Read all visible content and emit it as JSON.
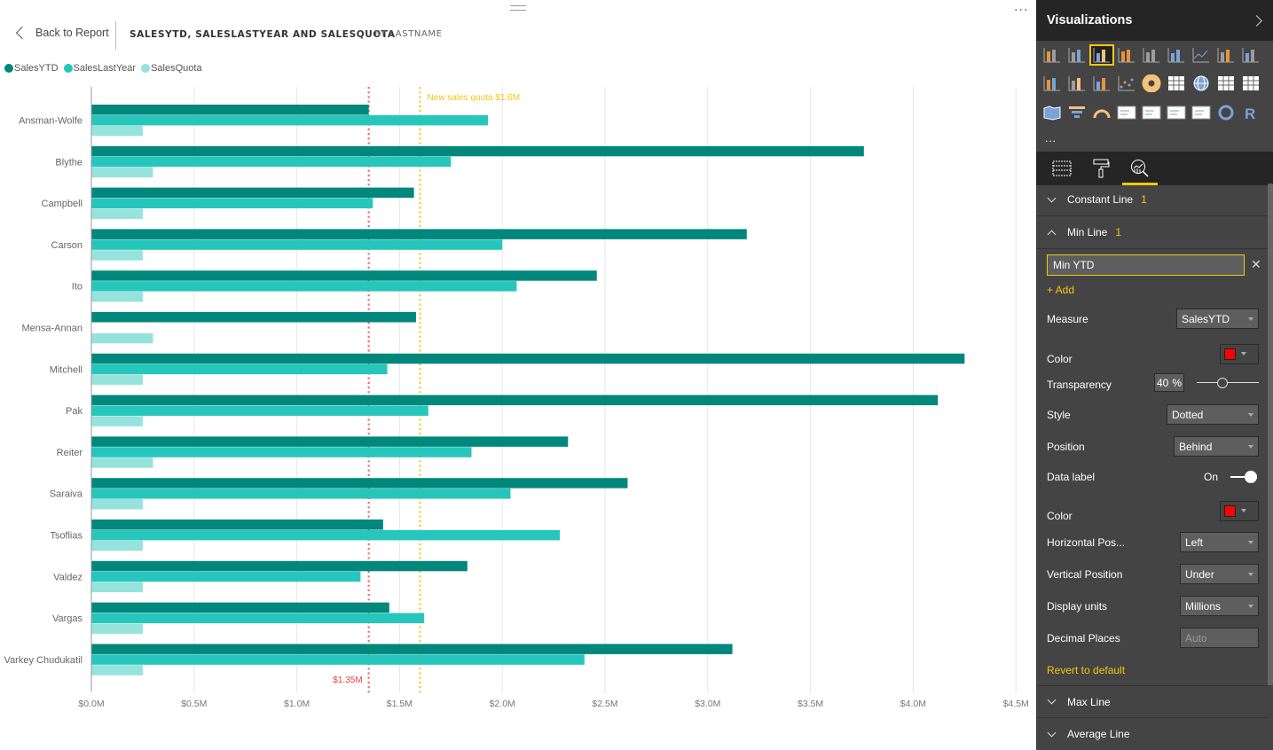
{
  "report": {
    "back_label": "Back to Report",
    "title": "SALESYTD, SALESLASTYEAR AND SALESQUOTA",
    "subtitle": "BY LASTNAME",
    "more_label": "...",
    "legend": [
      {
        "name": "SalesYTD",
        "color": "#01877b"
      },
      {
        "name": "SalesLastYear",
        "color": "#26c6bc"
      },
      {
        "name": "SalesQuota",
        "color": "#95e3dc"
      }
    ]
  },
  "chart_data": {
    "type": "bar",
    "orientation": "horizontal",
    "title": "SalesYTD, SalesLastYear and SalesQuota by LastName",
    "xlabel": "",
    "ylabel": "",
    "xlim": [
      0,
      4.5
    ],
    "units": "$M",
    "grid": true,
    "legend_position": "top-left",
    "x_ticks": [
      "$0.0M",
      "$0.5M",
      "$1.0M",
      "$1.5M",
      "$2.0M",
      "$2.5M",
      "$3.0M",
      "$3.5M",
      "$4.0M",
      "$4.5M"
    ],
    "x_tick_values": [
      0,
      0.5,
      1.0,
      1.5,
      2.0,
      2.5,
      3.0,
      3.5,
      4.0,
      4.5
    ],
    "categories": [
      "Ansman-Wolfe",
      "Blythe",
      "Campbell",
      "Carson",
      "Ito",
      "Mensa-Annan",
      "Mitchell",
      "Pak",
      "Reiter",
      "Saraiva",
      "Tsoflias",
      "Valdez",
      "Vargas",
      "Varkey Chudukatil"
    ],
    "series": [
      {
        "name": "SalesYTD",
        "color": "#01877b",
        "values": [
          1.35,
          3.76,
          1.57,
          3.19,
          2.46,
          1.58,
          4.25,
          4.12,
          2.32,
          2.61,
          1.42,
          1.83,
          1.45,
          3.12
        ]
      },
      {
        "name": "SalesLastYear",
        "color": "#26c6bc",
        "values": [
          1.93,
          1.75,
          1.37,
          2.0,
          2.07,
          0,
          1.44,
          1.64,
          1.85,
          2.04,
          2.28,
          1.31,
          1.62,
          2.4
        ]
      },
      {
        "name": "SalesQuota",
        "color": "#95e3dc",
        "values": [
          0.25,
          0.3,
          0.25,
          0.25,
          0.25,
          0.3,
          0.25,
          0.25,
          0.3,
          0.25,
          0.25,
          0.25,
          0.25,
          0.25
        ]
      }
    ],
    "reference_lines": [
      {
        "name": "Min YTD",
        "type": "min",
        "value": 1.35,
        "label": "$1.35M",
        "color": "#e8413c",
        "style": "dotted",
        "label_position": "bottom-left"
      },
      {
        "name": "New sales quota",
        "type": "constant",
        "value": 1.6,
        "label": "New sales quota $1.6M",
        "color": "#f2c811",
        "style": "dotted",
        "label_position": "top-right"
      }
    ]
  },
  "pane": {
    "title": "Visualizations",
    "viz_icons": [
      "stacked-bar-icon",
      "stacked-column-icon",
      "clustered-bar-icon",
      "clustered-column-icon",
      "100-stacked-bar-icon",
      "100-stacked-column-icon",
      "line-chart-icon",
      "area-chart-icon",
      "stacked-area-icon",
      "line-stacked-column-icon",
      "line-clustered-column-icon",
      "ribbon-chart-icon",
      "scatter-chart-icon",
      "pie-chart-icon",
      "treemap-icon",
      "map-icon",
      "table-icon",
      "matrix-icon",
      "filled-map-icon",
      "funnel-icon",
      "gauge-icon",
      "multi-row-card-icon",
      "card-icon",
      "kpi-icon",
      "slicer-icon",
      "donut-icon",
      "r-visual-icon"
    ],
    "selected_viz": 2,
    "more_label": "...",
    "tabs": [
      "fields-tab",
      "format-tab",
      "analytics-tab"
    ],
    "active_tab": 2,
    "sections": {
      "constant_line": {
        "label": "Constant Line",
        "count": "1"
      },
      "min_line": {
        "label": "Min Line",
        "count": "1"
      },
      "max_line": {
        "label": "Max Line"
      },
      "average_line": {
        "label": "Average Line"
      }
    },
    "min_line": {
      "name_value": "Min YTD",
      "add_label": "+ Add",
      "measure_label": "Measure",
      "measure_value": "SalesYTD",
      "color_label": "Color",
      "line_color": "#ff0000",
      "transparency_label": "Transparency",
      "transparency_value": "40",
      "transparency_unit": "%",
      "transparency_fraction": 0.4,
      "style_label": "Style",
      "style_value": "Dotted",
      "position_label": "Position",
      "position_value": "Behind",
      "data_label_label": "Data label",
      "data_label_state": "On",
      "label_color_label": "Color",
      "label_color": "#ff0000",
      "hpos_label": "Horizontal Pos...",
      "hpos_value": "Left",
      "vpos_label": "Vertical Position",
      "vpos_value": "Under",
      "units_label": "Display units",
      "units_value": "Millions",
      "decimals_label": "Decimal Places",
      "decimals_placeholder": "Auto",
      "revert_label": "Revert to default"
    }
  }
}
